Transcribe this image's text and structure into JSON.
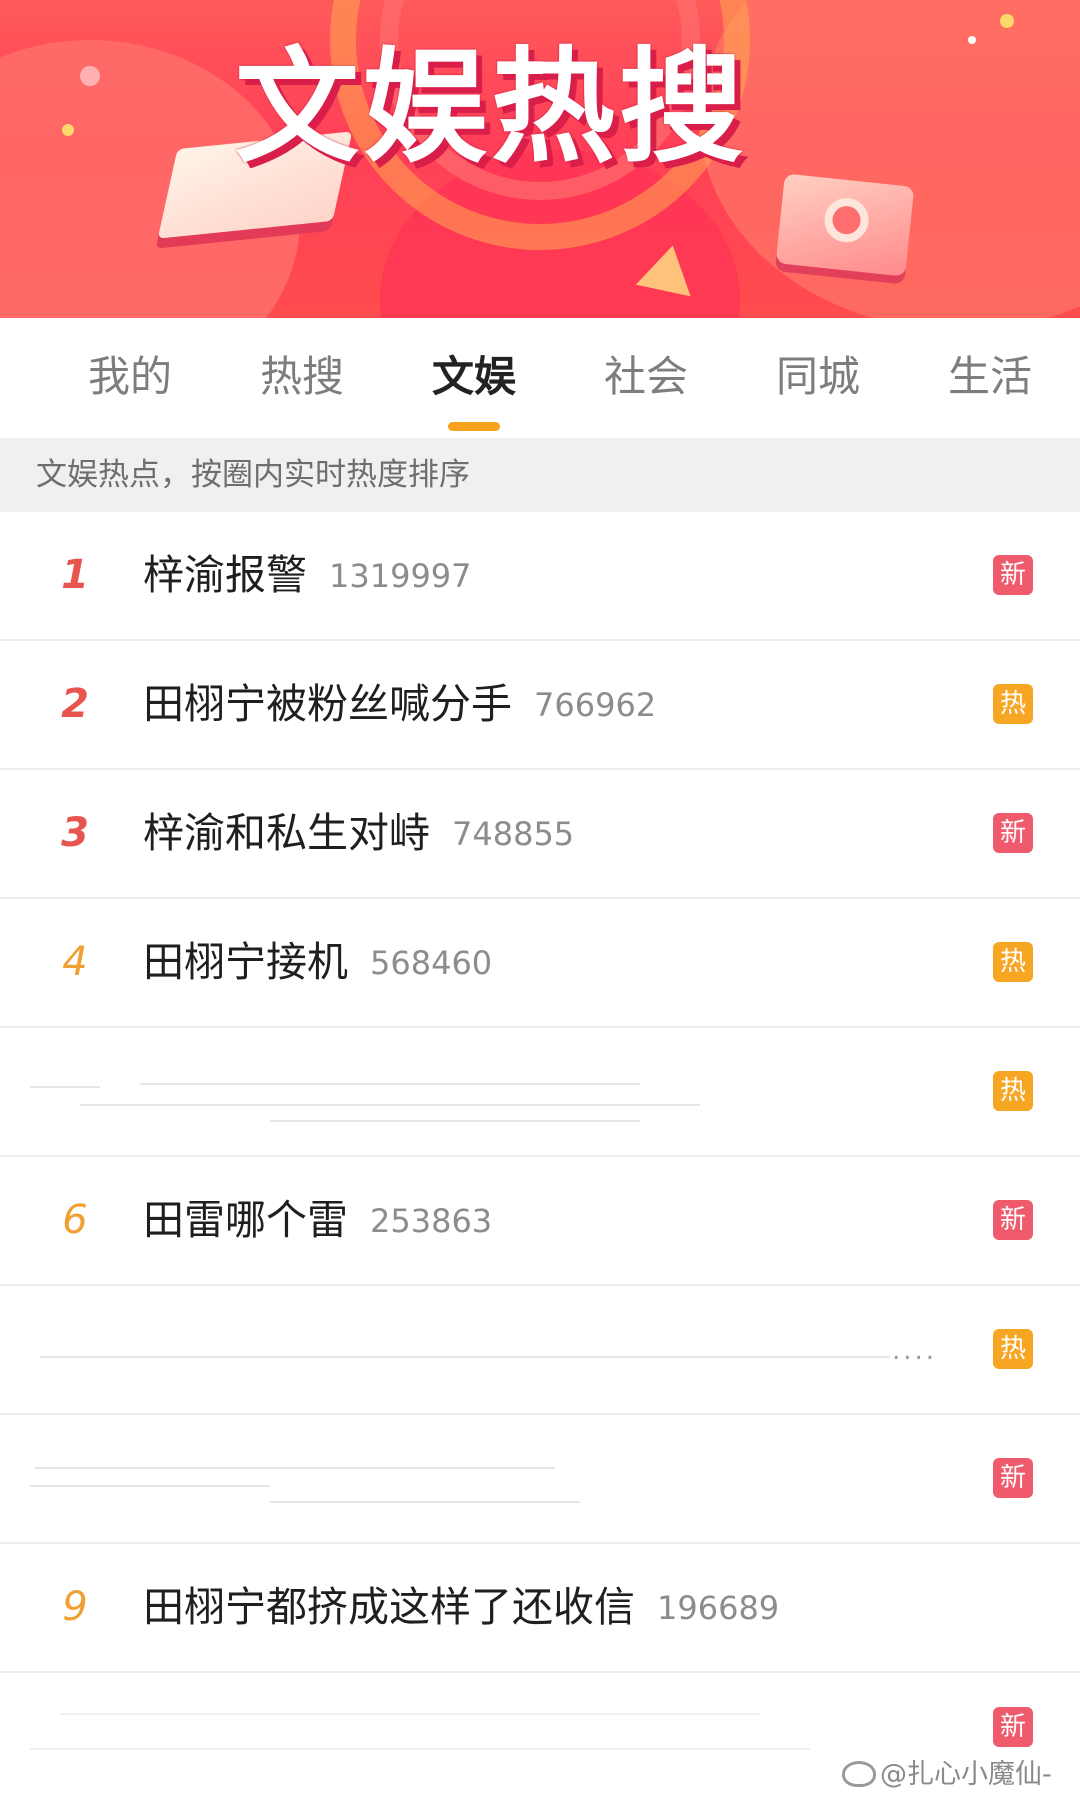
{
  "banner": {
    "title": "文娱热搜"
  },
  "tabs": [
    {
      "label": "我的",
      "active": false
    },
    {
      "label": "热搜",
      "active": false
    },
    {
      "label": "文娱",
      "active": true
    },
    {
      "label": "社会",
      "active": false
    },
    {
      "label": "同城",
      "active": false
    },
    {
      "label": "生活",
      "active": false
    }
  ],
  "subheader": "文娱热点，按圈内实时热度排序",
  "colors": {
    "accent_underline": "#f7a21a",
    "rank_top": "#e8544e",
    "rank_mid": "#f0a032",
    "badge_new": "#ef5a6c",
    "badge_hot": "#f6a623"
  },
  "list": [
    {
      "rank": "1",
      "title": "梓渝报警",
      "count": "1319997",
      "badge": "新",
      "badge_type": "new"
    },
    {
      "rank": "2",
      "title": "田栩宁被粉丝喊分手",
      "count": "766962",
      "badge": "热",
      "badge_type": "hot"
    },
    {
      "rank": "3",
      "title": "梓渝和私生对峙",
      "count": "748855",
      "badge": "新",
      "badge_type": "new"
    },
    {
      "rank": "4",
      "title": "田栩宁接机",
      "count": "568460",
      "badge": "热",
      "badge_type": "hot"
    },
    {
      "rank": "",
      "title": "",
      "count": "",
      "badge": "热",
      "badge_type": "hot",
      "redacted": true
    },
    {
      "rank": "6",
      "title": "田雷哪个雷",
      "count": "253863",
      "badge": "新",
      "badge_type": "new"
    },
    {
      "rank": "",
      "title": "",
      "count": "",
      "badge": "热",
      "badge_type": "hot",
      "redacted": true,
      "ellipsis": "...."
    },
    {
      "rank": "",
      "title": "",
      "count": "",
      "badge": "新",
      "badge_type": "new",
      "redacted": true
    },
    {
      "rank": "9",
      "title": "田栩宁都挤成这样了还收信",
      "count": "196689",
      "badge": "",
      "badge_type": ""
    },
    {
      "rank": "",
      "title": "",
      "count": "",
      "badge": "新",
      "badge_type": "new",
      "redacted": true
    }
  ],
  "watermark": "@扎心小魔仙-"
}
